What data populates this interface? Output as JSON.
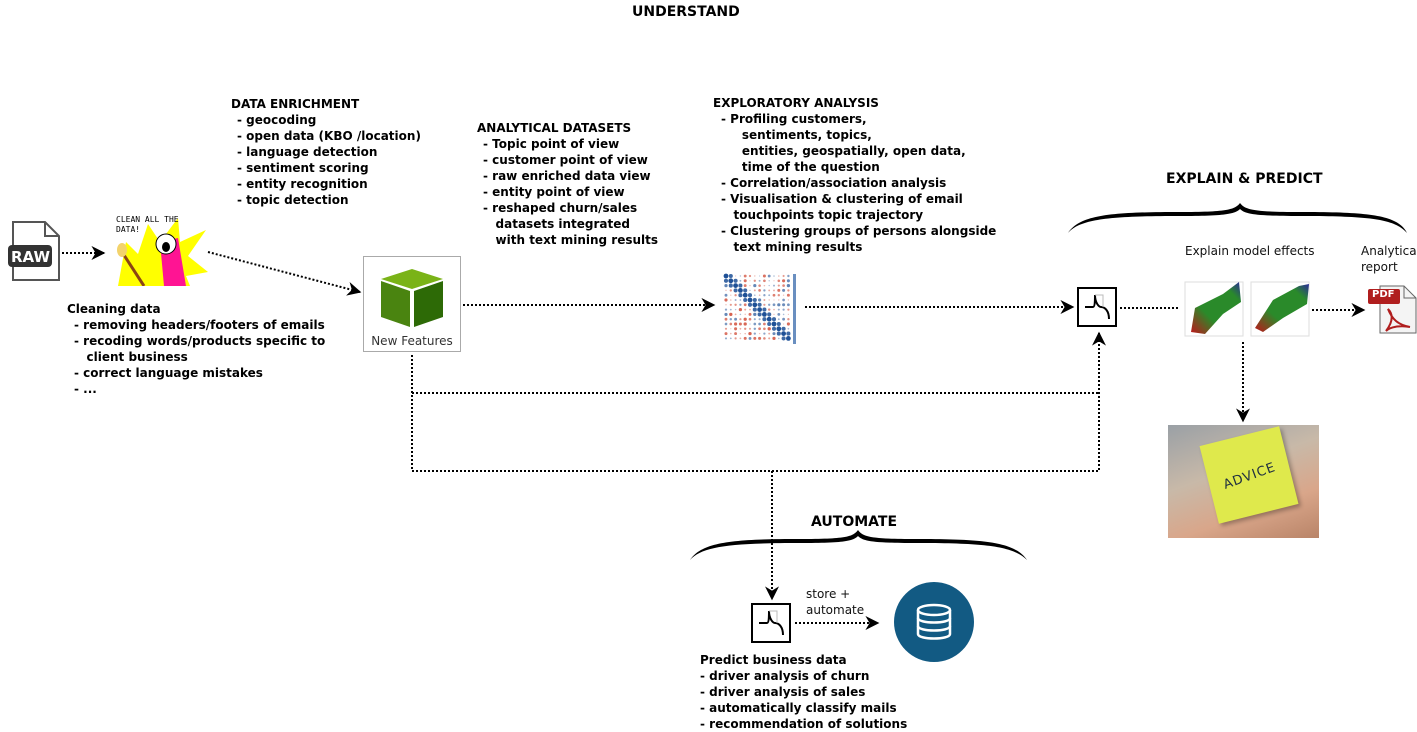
{
  "title": "UNDERSTAND",
  "data_enrichment": {
    "heading": "DATA ENRICHMENT",
    "items": [
      "- geocoding",
      "- open data (KBO /location)",
      "- language detection",
      "- sentiment scoring",
      "- entity recognition",
      "- topic detection"
    ]
  },
  "cleaning": {
    "heading": "Cleaning data",
    "items": [
      "- removing headers/footers of emails",
      "- recoding words/products specific to",
      "   client business",
      "- correct language mistakes",
      "- ..."
    ]
  },
  "analytical_datasets": {
    "heading": "ANALYTICAL DATASETS",
    "items": [
      "- Topic point of view",
      "- customer point of view",
      "- raw enriched data view",
      "- entity point of view",
      "- reshaped churn/sales",
      "   datasets integrated",
      "   with text mining results"
    ]
  },
  "exploratory": {
    "heading": "EXPLORATORY ANALYSIS",
    "items": [
      "- Profiling customers,",
      "     sentiments, topics,",
      "     entities, geospatially, open data,",
      "     time of the question",
      "- Correlation/association analysis",
      "- Visualisation & clustering of email",
      "   touchpoints topic trajectory",
      "- Clustering groups of persons alongside",
      "   text mining results"
    ]
  },
  "explain": {
    "heading": "EXPLAIN & PREDICT",
    "model_effects_label": "Explain model effects",
    "report_label": "Analytical\nreport",
    "pdf_badge": "PDF",
    "advice_text": "ADVICE"
  },
  "automate": {
    "heading": "AUTOMATE",
    "store_label": "store +\nautomate",
    "predict_heading": "Predict business data",
    "items": [
      "- driver analysis of churn",
      "- driver analysis of sales",
      "- automatically classify mails",
      "- recommendation of solutions"
    ]
  },
  "raw_label": "RAW",
  "clean_meme_text": "CLEAN ALL THE DATA!",
  "new_features_label": "New Features",
  "colors": {
    "new_features_green": "#3f7d0e",
    "database_blue": "#125a83",
    "meme_yellow": "#ffff00",
    "meme_pink": "#ff1493"
  }
}
